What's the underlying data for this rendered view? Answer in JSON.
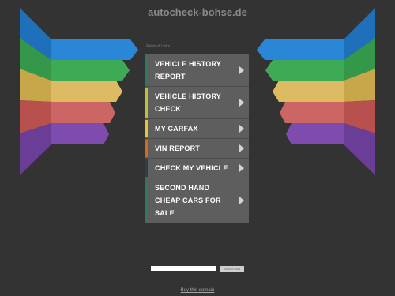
{
  "site": {
    "title": "autocheck-bohse.de"
  },
  "related_label": "Related Links",
  "menu": {
    "items": [
      {
        "label": "VEHICLE HISTORY REPORT",
        "accent": "#2f7a5e"
      },
      {
        "label": "VEHICLE HISTORY CHECK",
        "accent": "#b8c23a"
      },
      {
        "label": "MY CARFAX",
        "accent": "#e6c62e"
      },
      {
        "label": "VIN REPORT",
        "accent": "#d36b1e"
      },
      {
        "label": "CHECK MY VEHICLE",
        "accent": "#2a3f48"
      },
      {
        "label": "SECOND HAND CHEAP CARS FOR SALE",
        "accent": "#2f7a5e"
      }
    ]
  },
  "search": {
    "value": "",
    "button_label": "Search Ads"
  },
  "footer": {
    "link_label": "Buy this domain"
  },
  "colors": {
    "background": "#333333",
    "menu_background": "#5e5e5e",
    "stripes": [
      "#1f70bb",
      "#35974a",
      "#c8a64a",
      "#b8504e",
      "#6a3d96"
    ]
  }
}
